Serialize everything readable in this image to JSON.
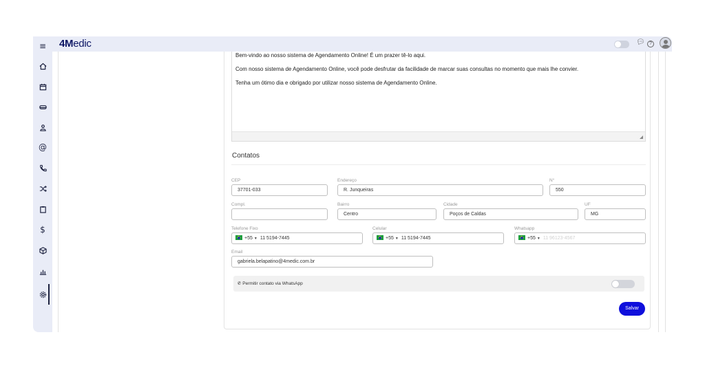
{
  "header": {
    "logo_bold": "4M",
    "logo_rest": "edic",
    "icons": [
      "toggle-switch",
      "chat-icon",
      "help-icon",
      "user-avatar-icon"
    ]
  },
  "sidebar": {
    "icons": [
      "menu-icon",
      "home-icon",
      "calendar-icon",
      "sofa-icon",
      "user-icon",
      "at-sign-icon",
      "phone-icon",
      "shuffle-icon",
      "clipboard-icon",
      "dollar-icon",
      "package-icon",
      "chart-icon",
      "gear-icon"
    ],
    "active": "gear-icon"
  },
  "welcome_text": {
    "line1": "Bem-vindo ao nosso sistema de Agendamento Online! É um prazer tê-lo aqui.",
    "line2": "Com nosso sistema de Agendamento Online, você pode desfrutar da facilidade de marcar suas consultas no momento que mais lhe convier.",
    "line3": "Tenha um ótimo dia e obrigado por utilizar nosso sistema de Agendamento Online."
  },
  "contacts": {
    "title": "Contatos",
    "cep": {
      "label": "CEP",
      "value": "37701-033"
    },
    "endereco": {
      "label": "Endereço",
      "value": "R. Junqueiras"
    },
    "numero": {
      "label": "N°",
      "value": "550"
    },
    "compl": {
      "label": "Compl.",
      "value": ""
    },
    "bairro": {
      "label": "Bairro",
      "value": "Centro"
    },
    "cidade": {
      "label": "Cidade",
      "value": "Poços de Caldas"
    },
    "uf": {
      "label": "UF",
      "value": "MG"
    },
    "telefone_fixo": {
      "label": "Telefone Fixo",
      "ddi": "+55",
      "value": "11 5194-7445"
    },
    "celular": {
      "label": "Celular",
      "ddi": "+55",
      "value": "11 5194-7445"
    },
    "whatsapp": {
      "label": "Whatsapp",
      "ddi": "+55",
      "placeholder": "11 96123-4567"
    },
    "email": {
      "label": "Email",
      "value": "gabriela.belapatino@4medic.com.br"
    },
    "whatsapp_permission": {
      "label": "Permitir contato via WhatsApp",
      "enabled": false
    }
  },
  "actions": {
    "save_label": "Salvar"
  },
  "colors": {
    "brand": "#0a1463",
    "primary_button": "#0f0fdc",
    "sidebar_bg": "#e9ecf7"
  }
}
